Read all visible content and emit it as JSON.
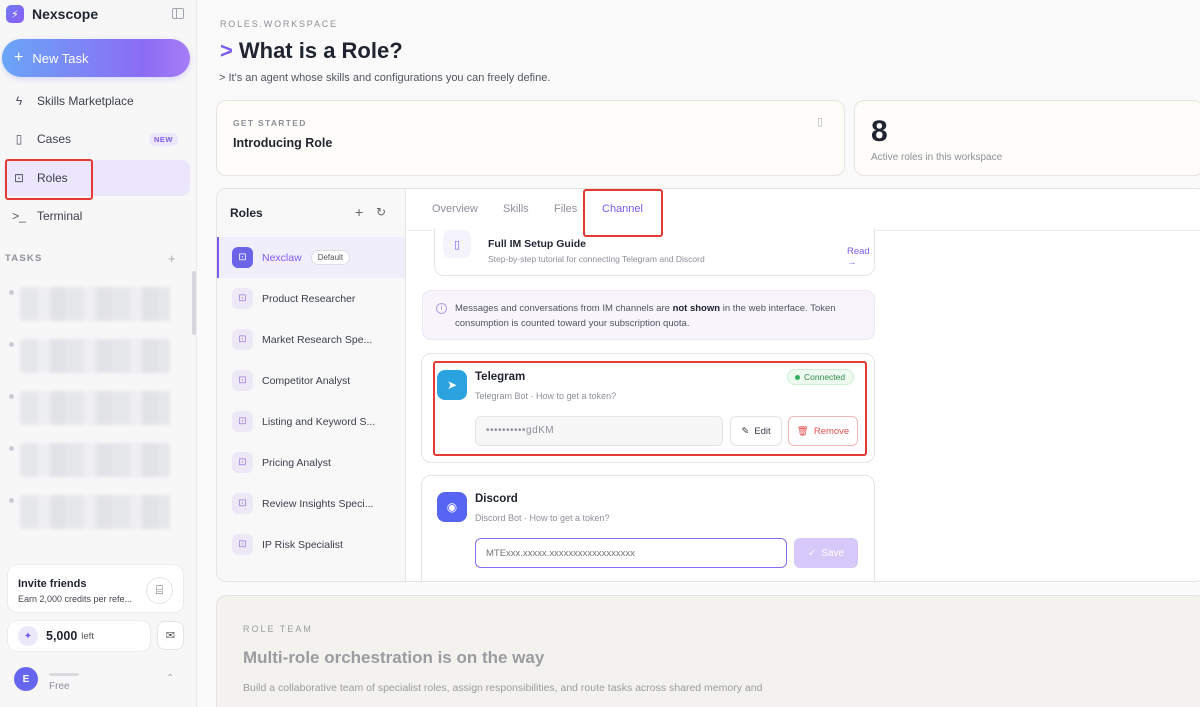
{
  "sidebar": {
    "brand": "Nexscope",
    "new_task": "New Task",
    "nav": [
      {
        "label": "Skills Marketplace",
        "icon": "bolt-icon"
      },
      {
        "label": "Cases",
        "icon": "book-icon",
        "badge": "NEW"
      },
      {
        "label": "Roles",
        "icon": "robot-icon"
      },
      {
        "label": "Terminal",
        "icon": "terminal-icon"
      }
    ],
    "tasks_heading": "TASKS",
    "invite": {
      "title": "Invite friends",
      "subtitle": "Earn 2,000 credits per refe..."
    },
    "credits": {
      "amount": "5,000",
      "suffix": "left"
    },
    "user": {
      "initial": "E",
      "plan": "Free"
    }
  },
  "header": {
    "eyebrow": "ROLES.WORKSPACE",
    "prompt_mark": ">",
    "title": "What is a Role?",
    "subtitle": "> It's an agent whose skills and configurations you can freely define."
  },
  "get_started": {
    "label": "GET STARTED",
    "title": "Introducing Role"
  },
  "stats": {
    "count": "8",
    "label": "Active roles in this workspace"
  },
  "roles_panel": {
    "heading": "Roles",
    "default_badge": "Default",
    "roles": [
      "Nexclaw",
      "Product Researcher",
      "Market Research Spe...",
      "Competitor Analyst",
      "Listing and Keyword S...",
      "Pricing Analyst",
      "Review Insights Speci...",
      "IP Risk Specialist"
    ]
  },
  "tabs": [
    "Overview",
    "Skills",
    "Files",
    "Channel"
  ],
  "guide": {
    "title": "Full IM Setup Guide",
    "subtitle": "Step-by-step tutorial for connecting Telegram and Discord",
    "link": "Read →"
  },
  "notice": {
    "before": "Messages and conversations from IM channels are ",
    "bold": "not shown",
    "after": " in the web interface. Token consumption is counted toward your subscription quota."
  },
  "telegram": {
    "name": "Telegram",
    "subtitle": "Telegram Bot · How to get a token?",
    "status": "Connected",
    "token": "••••••••••gdKM",
    "edit": "Edit",
    "remove": "Remove"
  },
  "discord": {
    "name": "Discord",
    "subtitle": "Discord Bot · How to get a token?",
    "placeholder": "MTExxx.xxxxx.xxxxxxxxxxxxxxxxxx",
    "save": "Save"
  },
  "team": {
    "label": "ROLE TEAM",
    "title": "Multi-role orchestration is on the way",
    "description": "Build a collaborative team of specialist roles, assign responsibilities, and route tasks across shared memory and"
  },
  "colors": {
    "accent": "#7b5cf0",
    "highlight": "#e53935",
    "telegram": "#2aa3e0",
    "discord": "#5865f2",
    "success": "#2fb35a"
  }
}
